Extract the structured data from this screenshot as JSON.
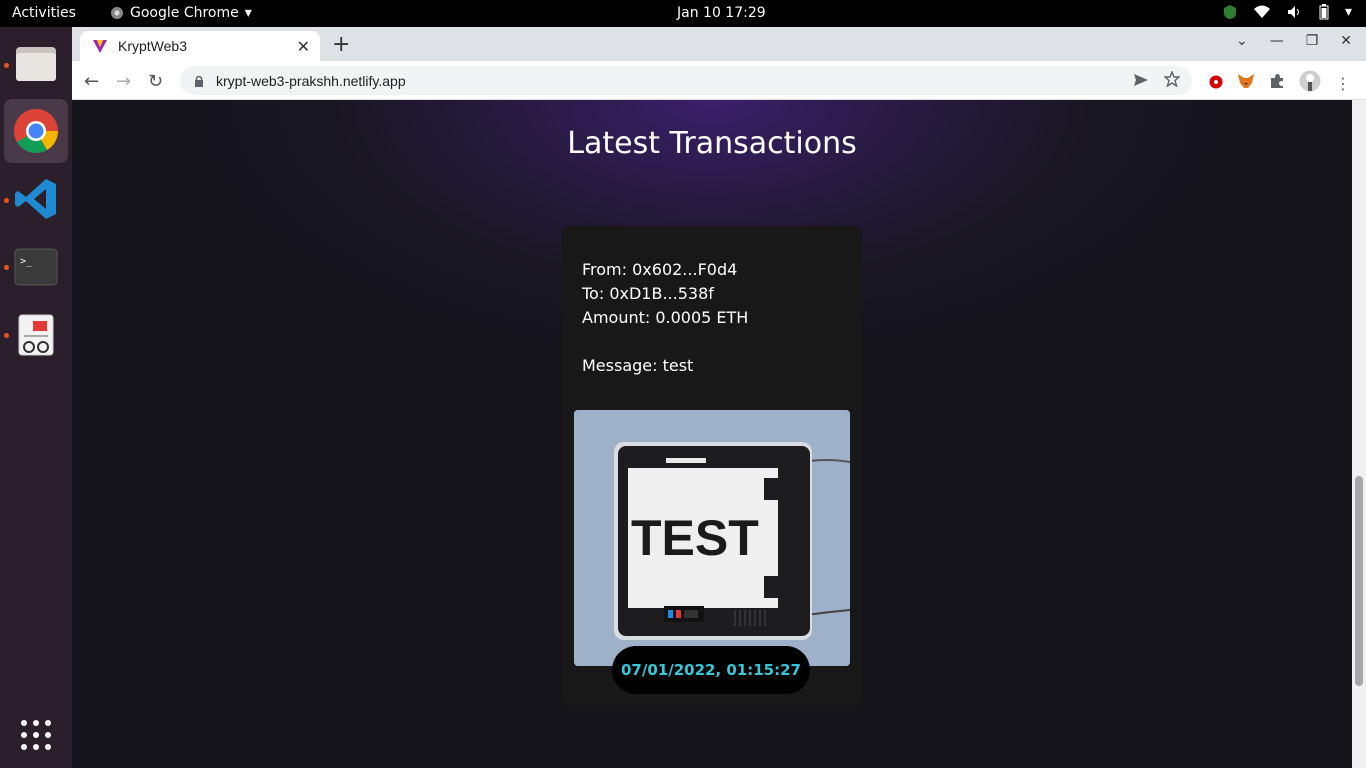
{
  "topbar": {
    "activities": "Activities",
    "app_name": "Google Chrome",
    "clock": "Jan 10  17:29"
  },
  "dock": {
    "items": [
      "files",
      "chrome",
      "vscode",
      "terminal",
      "document-viewer",
      "show-apps"
    ]
  },
  "browser": {
    "tab_title": "KryptWeb3",
    "url": "krypt-web3-prakshh.netlify.app"
  },
  "page": {
    "heading": "Latest Transactions",
    "transaction": {
      "from": "From: 0x602...F0d4",
      "to": "To: 0xD1B...538f",
      "amount": "Amount: 0.0005 ETH",
      "message": "Message: test",
      "image_text": "TEST",
      "timestamp": "07/01/2022, 01:15:27"
    }
  },
  "colors": {
    "accent": "#37c7da",
    "card": "#181818",
    "dock": "#2b1f2b"
  }
}
